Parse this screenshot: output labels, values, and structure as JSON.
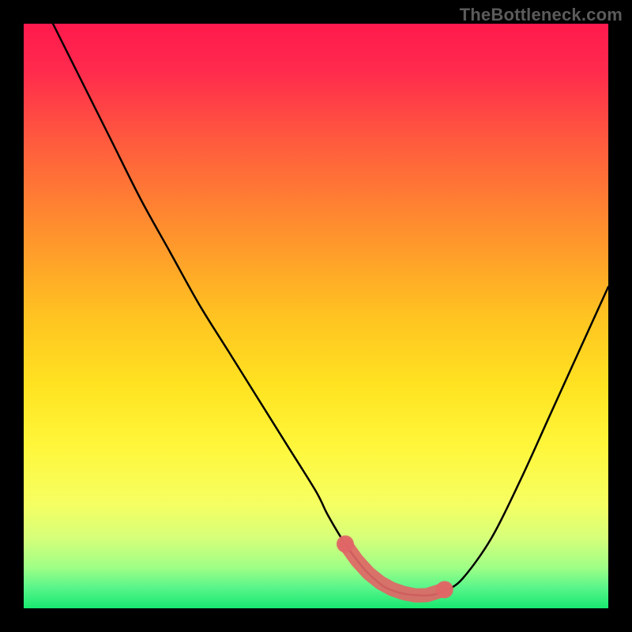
{
  "watermark": "TheBottleneck.com",
  "colors": {
    "frame": "#000000",
    "curve_stroke": "#000000",
    "marker_fill": "#e06666",
    "marker_stroke": "#e06666",
    "gradient_stops": [
      {
        "offset": 0.0,
        "color": "#ff1a4d"
      },
      {
        "offset": 0.08,
        "color": "#ff2a4d"
      },
      {
        "offset": 0.2,
        "color": "#ff5a3e"
      },
      {
        "offset": 0.35,
        "color": "#ff8f2e"
      },
      {
        "offset": 0.5,
        "color": "#ffc321"
      },
      {
        "offset": 0.62,
        "color": "#ffe321"
      },
      {
        "offset": 0.72,
        "color": "#fff63a"
      },
      {
        "offset": 0.82,
        "color": "#f6ff61"
      },
      {
        "offset": 0.88,
        "color": "#d6ff7a"
      },
      {
        "offset": 0.93,
        "color": "#9fff86"
      },
      {
        "offset": 0.965,
        "color": "#58f58a"
      },
      {
        "offset": 1.0,
        "color": "#18e870"
      }
    ]
  },
  "chart_data": {
    "type": "line",
    "title": "",
    "xlabel": "",
    "ylabel": "",
    "xlim": [
      0,
      100
    ],
    "ylim": [
      0,
      100
    ],
    "grid": false,
    "series": [
      {
        "name": "curve",
        "x": [
          5,
          10,
          15,
          20,
          25,
          30,
          35,
          40,
          45,
          50,
          52,
          55,
          58,
          60,
          62,
          65,
          68,
          70,
          72,
          75,
          80,
          85,
          90,
          95,
          100
        ],
        "y": [
          100,
          90,
          80,
          70,
          61,
          52,
          44,
          36,
          28,
          20,
          16,
          11,
          7,
          5,
          3.5,
          2.5,
          2.2,
          2.3,
          3.0,
          5,
          12,
          22,
          33,
          44,
          55
        ]
      }
    ],
    "markers": {
      "name": "highlight-segment",
      "x": [
        55,
        57,
        59,
        61,
        63,
        65,
        67,
        69,
        71,
        72
      ],
      "y": [
        11,
        8.2,
        6.0,
        4.4,
        3.3,
        2.6,
        2.2,
        2.25,
        2.9,
        3.2
      ]
    }
  }
}
